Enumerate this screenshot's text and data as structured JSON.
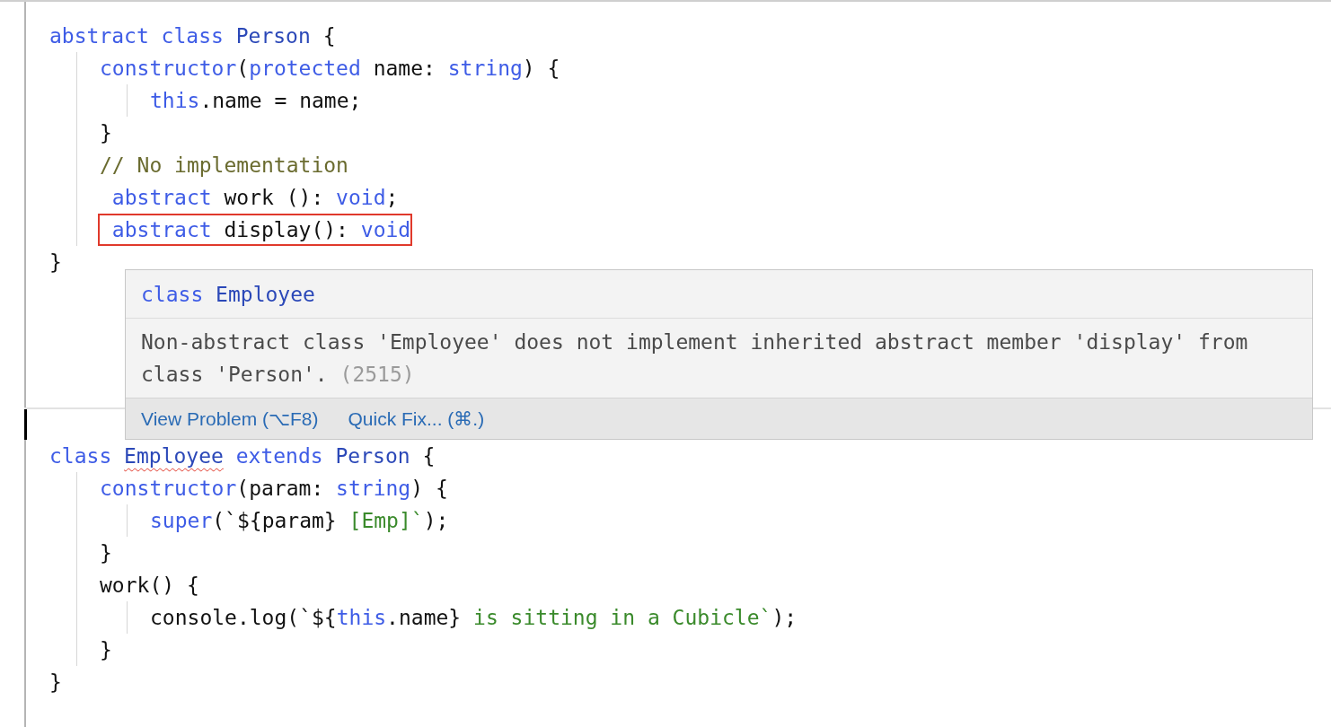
{
  "code_top": [
    {
      "tokens": [
        {
          "kind": "keyword",
          "text": "abstract class "
        },
        {
          "kind": "type",
          "text": "Person"
        },
        {
          "kind": "plain",
          "text": " {"
        }
      ],
      "children": [
        {
          "tokens": [
            {
              "kind": "keyword",
              "text": "constructor"
            },
            {
              "kind": "plain",
              "text": "("
            },
            {
              "kind": "keyword",
              "text": "protected"
            },
            {
              "kind": "plain",
              "text": " name: "
            },
            {
              "kind": "keyword",
              "text": "string"
            },
            {
              "kind": "plain",
              "text": ") {"
            }
          ],
          "children": [
            {
              "tokens": [
                {
                  "kind": "keyword",
                  "text": "this"
                },
                {
                  "kind": "plain",
                  "text": ".name = name;"
                }
              ]
            }
          ]
        },
        {
          "tokens": [
            {
              "kind": "plain",
              "text": "}"
            }
          ]
        },
        {
          "tokens": [
            {
              "kind": "comment",
              "text": "// No implementation"
            }
          ]
        },
        {
          "tokens": [
            {
              "kind": "keyword",
              "text": " abstract"
            },
            {
              "kind": "plain",
              "text": " work (): "
            },
            {
              "kind": "keyword",
              "text": "void"
            },
            {
              "kind": "plain",
              "text": ";"
            }
          ]
        },
        {
          "tokens": [
            {
              "kind": "keyword",
              "text": " abstract"
            },
            {
              "kind": "plain",
              "text": " display(): "
            },
            {
              "kind": "keyword",
              "text": "void"
            }
          ],
          "boxed": true
        }
      ]
    },
    {
      "tokens": [
        {
          "kind": "plain",
          "text": "}"
        }
      ]
    }
  ],
  "hover": {
    "header": [
      {
        "kind": "keyword",
        "text": "class "
      },
      {
        "kind": "type",
        "text": "Employee"
      }
    ],
    "message": "Non-abstract class 'Employee' does not implement inherited abstract member 'display' from class 'Person'.",
    "code": "(2515)",
    "actions": [
      "View Problem (⌥F8)",
      "Quick Fix... (⌘.)"
    ]
  },
  "code_bottom": [
    {
      "tokens": [
        {
          "kind": "keyword",
          "text": "class "
        },
        {
          "kind": "type",
          "text": "Employee",
          "error": true
        },
        {
          "kind": "keyword",
          "text": " extends "
        },
        {
          "kind": "type",
          "text": "Person"
        },
        {
          "kind": "plain",
          "text": " {"
        }
      ],
      "children": [
        {
          "tokens": [
            {
              "kind": "keyword",
              "text": "constructor"
            },
            {
              "kind": "plain",
              "text": "(param: "
            },
            {
              "kind": "keyword",
              "text": "string"
            },
            {
              "kind": "plain",
              "text": ") {"
            }
          ],
          "children": [
            {
              "tokens": [
                {
                  "kind": "keyword",
                  "text": "super"
                },
                {
                  "kind": "plain",
                  "text": "(`${param} "
                },
                {
                  "kind": "string",
                  "text": "[Emp]`"
                },
                {
                  "kind": "plain",
                  "text": ");"
                }
              ]
            }
          ]
        },
        {
          "tokens": [
            {
              "kind": "plain",
              "text": "}"
            }
          ]
        },
        {
          "tokens": [
            {
              "kind": "plain",
              "text": "work() {"
            }
          ],
          "children": [
            {
              "tokens": [
                {
                  "kind": "plain",
                  "text": "console.log(`${"
                },
                {
                  "kind": "keyword",
                  "text": "this"
                },
                {
                  "kind": "plain",
                  "text": ".name} "
                },
                {
                  "kind": "string",
                  "text": "is sitting in a Cubicle`"
                },
                {
                  "kind": "plain",
                  "text": ");"
                }
              ]
            }
          ]
        },
        {
          "tokens": [
            {
              "kind": "plain",
              "text": "}"
            }
          ]
        }
      ]
    },
    {
      "tokens": [
        {
          "kind": "plain",
          "text": "}"
        }
      ]
    }
  ]
}
